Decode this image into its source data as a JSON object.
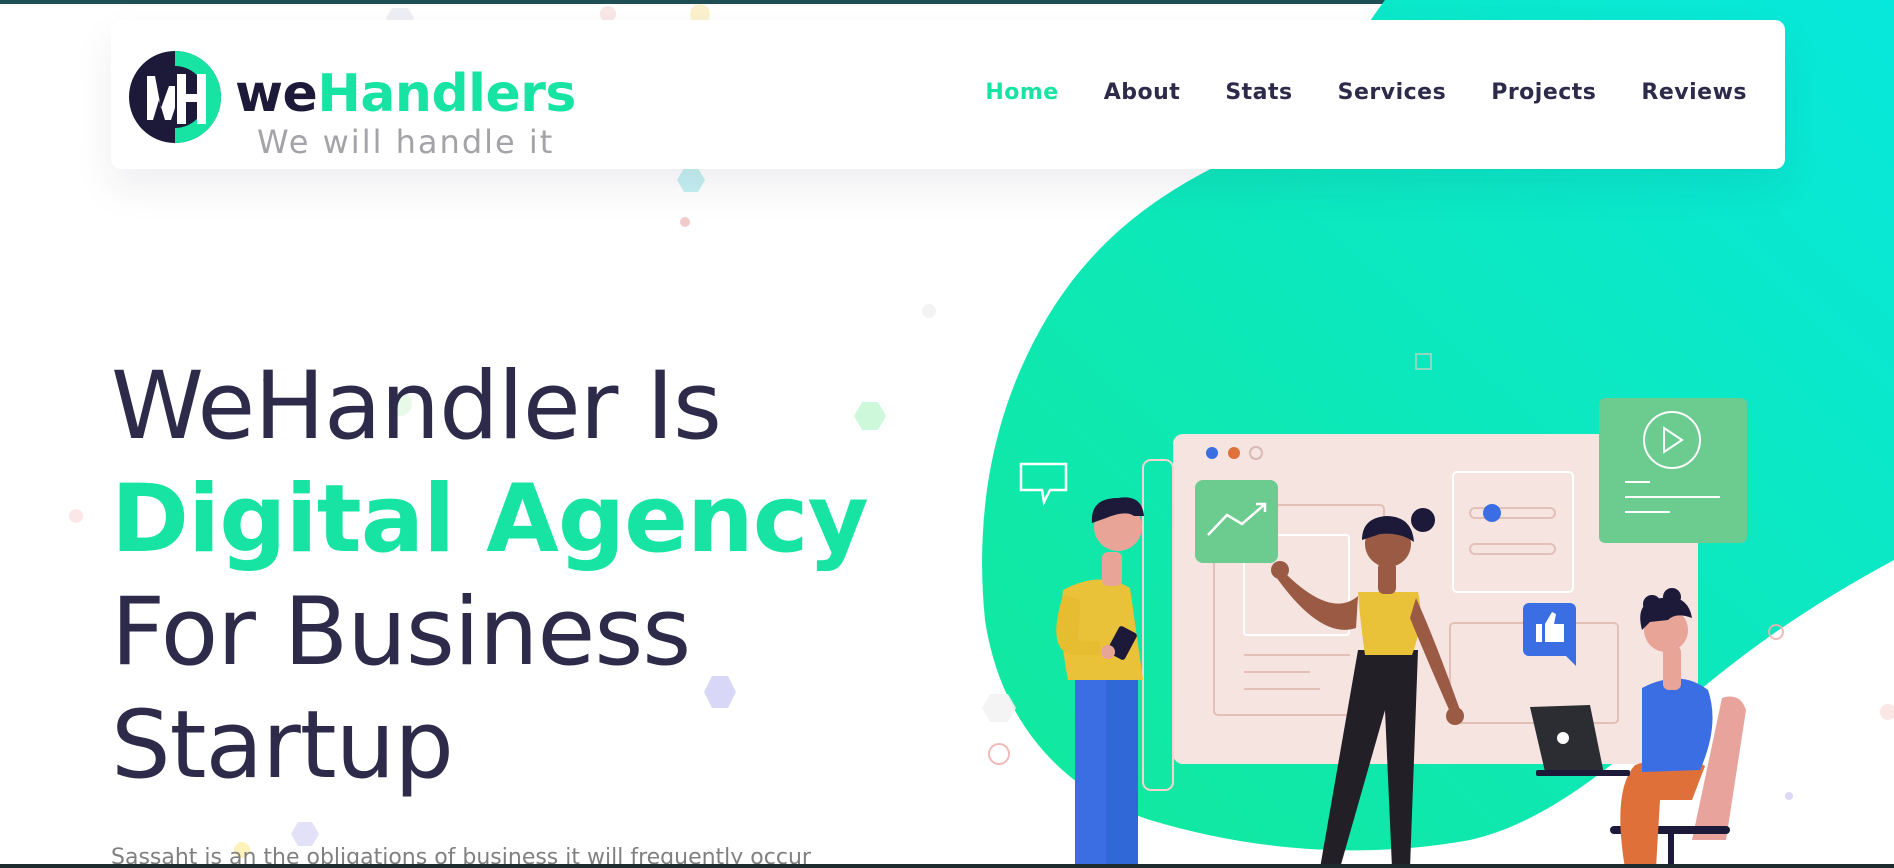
{
  "brand": {
    "name_part1": "we",
    "name_part2": "Handlers",
    "tagline": "We will handle it",
    "accent_color": "#17e3a2",
    "dark_color": "#1c1939"
  },
  "nav": {
    "items": [
      {
        "label": "Home",
        "active": true
      },
      {
        "label": "About",
        "active": false
      },
      {
        "label": "Stats",
        "active": false
      },
      {
        "label": "Services",
        "active": false
      },
      {
        "label": "Projects",
        "active": false
      },
      {
        "label": "Reviews",
        "active": false
      }
    ]
  },
  "hero": {
    "line1": "WeHandler Is",
    "line2": "Digital Agency",
    "line3": "For Business",
    "line4": "Startup",
    "subtitle": "Sassaht is an the obligations of business it will frequently occur"
  },
  "illustration": {
    "icons": [
      "chart-icon",
      "play-icon",
      "thumbs-up-icon",
      "chat-bubble-icon",
      "laptop-icon",
      "phone-icon"
    ]
  }
}
